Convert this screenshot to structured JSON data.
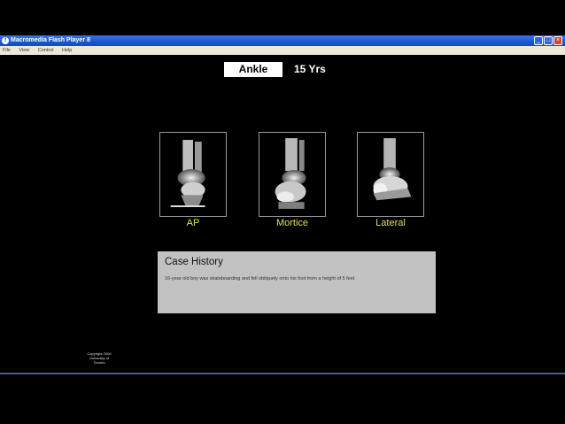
{
  "window": {
    "title": "Macromedia Flash Player 8",
    "buttons": {
      "minimize": "_",
      "maximize": "□",
      "close": "×"
    }
  },
  "menu": {
    "items": [
      "File",
      "View",
      "Control",
      "Help"
    ]
  },
  "header": {
    "region": "Ankle",
    "age": "15 Yrs"
  },
  "views": [
    {
      "label": "AP",
      "icon": "xray-ap-image"
    },
    {
      "label": "Mortice",
      "icon": "xray-mortice-image"
    },
    {
      "label": "Lateral",
      "icon": "xray-lateral-image"
    }
  ],
  "case_history": {
    "title": "Case History",
    "text": "16-year old boy was skateboarding and fell obliquely onto his foot from a height of 5 feet"
  },
  "copyright": [
    "Copyright 2006",
    "University of",
    "Toronto"
  ],
  "colors": {
    "label": "#e3df62",
    "case_box": "#c2c2c2",
    "titlebar": "#1f54d2"
  }
}
